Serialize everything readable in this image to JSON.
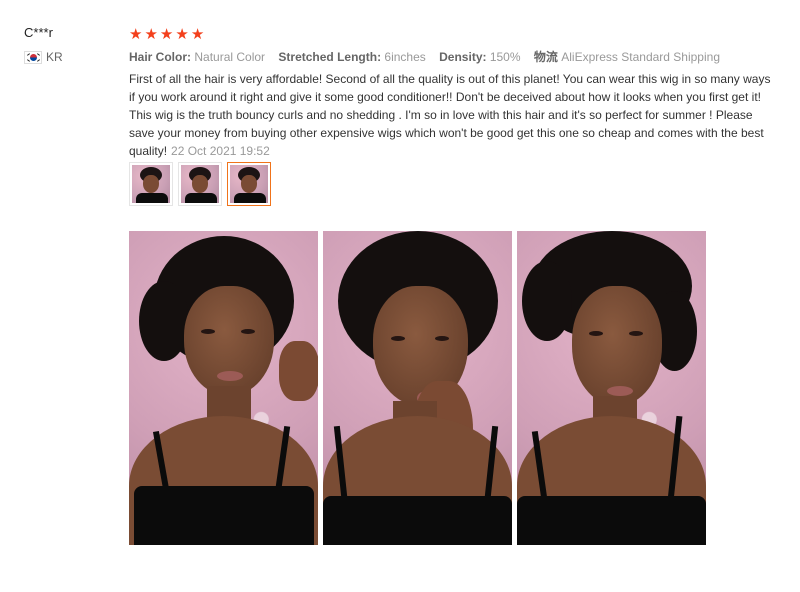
{
  "reviewer": {
    "name": "C***r",
    "country": "KR",
    "flag_icon": "south-korea-flag-icon"
  },
  "rating": {
    "stars": 5,
    "max": 5,
    "color": "#f3401c"
  },
  "attributes": [
    {
      "key": "Hair Color:",
      "value": "Natural Color"
    },
    {
      "key": "Stretched Length:",
      "value": "6inches"
    },
    {
      "key": "Density:",
      "value": "150%"
    },
    {
      "key": "物流",
      "value": "AliExpress Standard Shipping"
    }
  ],
  "review": {
    "text": "First of all the hair is very affordable! Second of all the quality is out of this planet! You can wear this wig in so many ways if you work around it right and give it some good conditioner!! Don't be deceived about how it looks when you first get it! This wig is the truth bouncy curls and no shedding . I'm so in love with this hair and it's so perfect for summer ! Please save your money from buying other expensive wigs which won't be good get this one so cheap and comes with the best quality!",
    "date": "22 Oct 2021 19:52"
  },
  "thumbnails": {
    "count": 3,
    "active_index": 2,
    "active_color": "#f0731a"
  },
  "photos": {
    "count": 3
  }
}
